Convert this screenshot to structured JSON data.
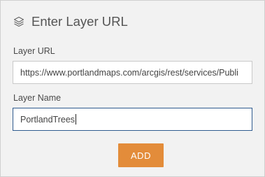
{
  "dialog": {
    "title": "Enter Layer URL",
    "title_icon": "layers-icon"
  },
  "fields": {
    "layer_url": {
      "label": "Layer URL",
      "value": "https://www.portlandmaps.com/arcgis/rest/services/Publi"
    },
    "layer_name": {
      "label": "Layer Name",
      "value": "PortlandTrees"
    }
  },
  "actions": {
    "add_label": "ADD"
  },
  "colors": {
    "panel_background": "#f2f2f2",
    "add_button": "#e38c3a",
    "focused_border": "#2f5b8f"
  }
}
